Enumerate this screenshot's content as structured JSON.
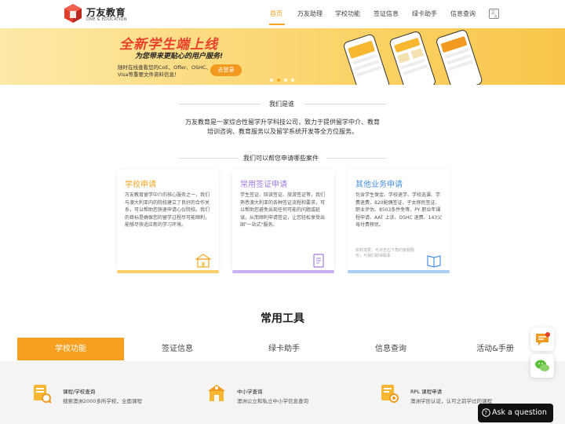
{
  "brand": {
    "name": "万友教育",
    "subtitle": "ONE & EDUCATION",
    "accent": "#f5a623",
    "red": "#e23c2a"
  },
  "nav": {
    "items": [
      "首页",
      "万友助理",
      "学校功能",
      "签证信息",
      "绿卡助手",
      "信息查询"
    ],
    "active_index": 0,
    "lang_icon": "translate-icon"
  },
  "banner": {
    "title": "全新学生端上线",
    "subtitle": "为您带来更贴心的用户服务!",
    "desc": "随时在线查看您的CoE、Offer、OSHC、Visa等重要文件资料信息！",
    "button": "去登录",
    "slides": 4,
    "active_slide": 1
  },
  "about": {
    "title": "我们是谁",
    "text": "万友教育是一家综合性留学升学科技公司，致力于提供留学中介、教育培训咨询、教育服务以及留学系统开发等全方位服务。"
  },
  "services": {
    "title": "我们可以帮您申请哪些案件",
    "cards": [
      {
        "title": "学校申请",
        "text": "万友教育留学中介的核心服务之一，我们与澳大利亚内的院校建立了良好的合作关系，可以帮助您快速申请心仪院校。我们的目标是确保您的留学过程尽可能顺利，能够尽快适应新的学习环境。",
        "fade": "",
        "color": "#f5a623",
        "bar": "#f8cf6a",
        "icon": "school-icon"
      },
      {
        "title": "常用签证申请",
        "text": "学生签证、陪读签证、旅游签证等，我们熟悉澳大利亚的各种签证流程和要求，可以帮助您避免出现任何可能的问题或延误，从而顺利申请签证，让您轻松享受出国\"一站式\"服务。",
        "fade": "",
        "color": "#a27be0",
        "bar": "#c9b0f0",
        "icon": "document-icon"
      },
      {
        "title": "其他业务申请",
        "text": "包含学生保金、学校退学、学校选课、学费退费、820配偶签证、子女移民签证、职业评估、8503条件免等、PY 职业年课程申请、AAT 上诉、OSHC 退费、143父母付费移民。",
        "fade": "如有需要，可点击右下角的客服服务，与我们取得联系",
        "color": "#4a90e2",
        "bar": "#a9cdf3",
        "icon": "book-icon"
      }
    ]
  },
  "tools": {
    "title": "常用工具",
    "tabs": [
      "学校功能",
      "签证信息",
      "绿卡助手",
      "信息查询",
      "活动&手册"
    ],
    "active_tab": 0,
    "items": [
      {
        "name": "课程/学校查询",
        "desc": "搜索澳洲2000多所学校，全面课程",
        "icon": "course-search-icon"
      },
      {
        "name": "中小学查询",
        "desc": "澳洲公立和私立中小学信息查询",
        "icon": "school-building-icon"
      },
      {
        "name": "RPL 课程申请",
        "desc": "澳洲学历认证，认可之前学过的课程",
        "icon": "certificate-icon"
      }
    ]
  },
  "floating": {
    "ask": "Ask a question"
  }
}
